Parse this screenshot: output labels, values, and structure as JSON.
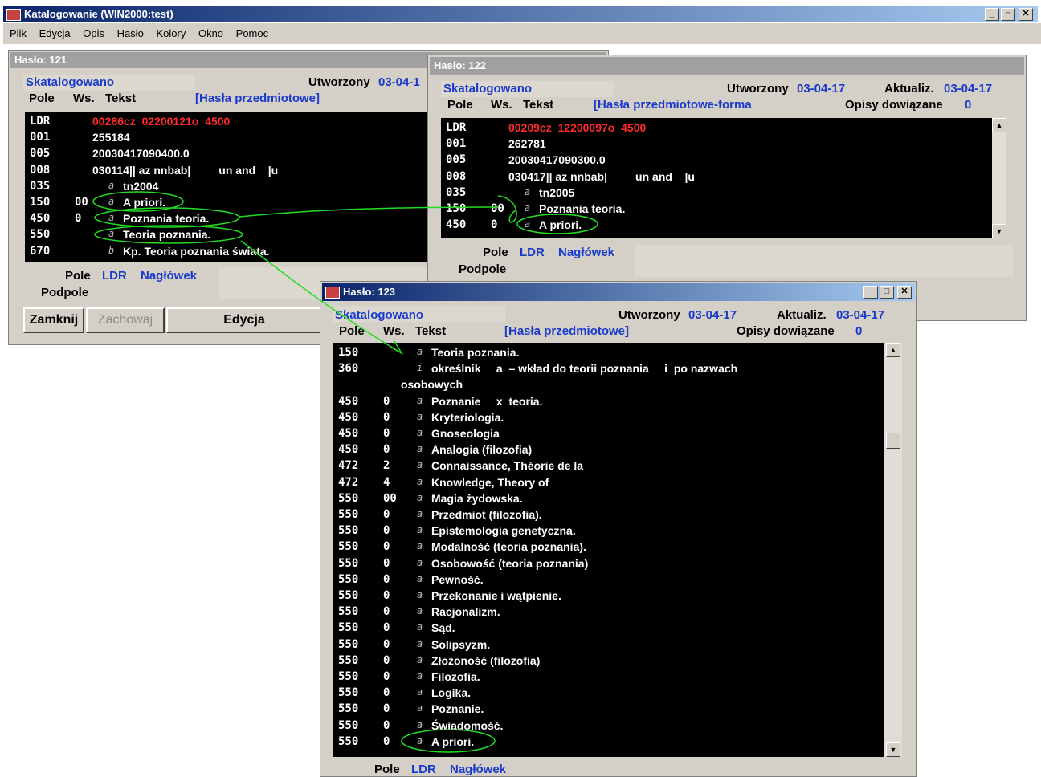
{
  "app": {
    "title": "Katalogowanie (WIN2000:test)",
    "controls": [
      "_",
      "▫",
      "✕"
    ]
  },
  "menu": [
    "Plik",
    "Edycja",
    "Opis",
    "Hasło",
    "Kolory",
    "Okno",
    "Pomoc"
  ],
  "w121": {
    "title": "Hasło: 121",
    "status": "Skatalogowano",
    "created_label": "Utworzony",
    "created": "03-04-1",
    "col_pole": "Pole",
    "col_ws": "Ws.",
    "col_tekst": "Tekst",
    "heading": "[Hasła przedmiotowe]",
    "rows": [
      {
        "tag": "LDR",
        "ind": "",
        "sf": "",
        "text": "00286cz  02200121o  4500",
        "red": true
      },
      {
        "tag": "001",
        "ind": "",
        "sf": "",
        "text": "255184"
      },
      {
        "tag": "005",
        "ind": "",
        "sf": "",
        "text": "20030417090400.0"
      },
      {
        "tag": "008",
        "ind": "",
        "sf": "",
        "text": "030114|| az nnbab|         un and    |u"
      },
      {
        "tag": "035",
        "ind": "",
        "sf": "a",
        "text": "tn2004"
      },
      {
        "tag": "150",
        "ind": "00",
        "sf": "a",
        "text": "A priori."
      },
      {
        "tag": "450",
        "ind": "0",
        "sf": "a",
        "text": "Poznania teoria."
      },
      {
        "tag": "550",
        "ind": "",
        "sf": "a",
        "text": "Teoria poznania."
      },
      {
        "tag": "670",
        "ind": "",
        "sf": "b",
        "text": "Kp. Teoria poznania świata."
      }
    ],
    "pole_label": "Pole",
    "ldr": "LDR",
    "naglowek": "Nagłówek",
    "podpole_label": "Podpole",
    "btn_close": "Zamknij",
    "btn_save": "Zachowaj",
    "btn_edit": "Edycja"
  },
  "w122": {
    "title": "Hasło: 122",
    "status": "Skatalogowano",
    "created_label": "Utworzony",
    "created": "03-04-17",
    "updated_label": "Aktualiz.",
    "updated": "03-04-17",
    "col_pole": "Pole",
    "col_ws": "Ws.",
    "col_tekst": "Tekst",
    "heading": "[Hasła przedmiotowe-forma",
    "linked_label": "Opisy dowiązane",
    "linked": "0",
    "rows": [
      {
        "tag": "LDR",
        "ind": "",
        "sf": "",
        "text": "00209cz  12200097o  4500",
        "red": true
      },
      {
        "tag": "001",
        "ind": "",
        "sf": "",
        "text": "262781"
      },
      {
        "tag": "005",
        "ind": "",
        "sf": "",
        "text": "20030417090300.0"
      },
      {
        "tag": "008",
        "ind": "",
        "sf": "",
        "text": "030417|| az nnbab|         un and    |u"
      },
      {
        "tag": "035",
        "ind": "",
        "sf": "a",
        "text": "tn2005"
      },
      {
        "tag": "150",
        "ind": "00",
        "sf": "a",
        "text": "Poznania teoria."
      },
      {
        "tag": "450",
        "ind": "0",
        "sf": "a",
        "text": "A priori."
      }
    ],
    "pole_label": "Pole",
    "ldr": "LDR",
    "naglowek": "Nagłówek",
    "podpole_label": "Podpole"
  },
  "w123": {
    "title": "Hasło: 123",
    "status": "Skatalogowano",
    "created_label": "Utworzony",
    "created": "03-04-17",
    "updated_label": "Aktualiz.",
    "updated": "03-04-17",
    "col_pole": "Pole",
    "col_ws": "Ws.",
    "col_tekst": "Tekst",
    "heading": "[Hasła przedmiotowe]",
    "linked_label": "Opisy dowiązane",
    "linked": "0",
    "rows": [
      {
        "tag": "150",
        "ind": "",
        "sf": "a",
        "text": "Teoria poznania."
      },
      {
        "tag": "360",
        "ind": "",
        "sf": "i",
        "text": "określnik     a  – wkład do teorii poznania     i  po nazwach"
      },
      {
        "tag": "",
        "ind": "",
        "sf": "",
        "text": "osobowych"
      },
      {
        "tag": "450",
        "ind": "0",
        "sf": "a",
        "text": "Poznanie     x  teoria."
      },
      {
        "tag": "450",
        "ind": "0",
        "sf": "a",
        "text": "Kryteriologia."
      },
      {
        "tag": "450",
        "ind": "0",
        "sf": "a",
        "text": "Gnoseologia"
      },
      {
        "tag": "450",
        "ind": "0",
        "sf": "a",
        "text": "Analogia (filozofia)"
      },
      {
        "tag": "472",
        "ind": "2",
        "sf": "a",
        "text": "Connaissance, Théorie de la"
      },
      {
        "tag": "472",
        "ind": "4",
        "sf": "a",
        "text": "Knowledge, Theory of"
      },
      {
        "tag": "550",
        "ind": "00",
        "sf": "a",
        "text": "Magia żydowska."
      },
      {
        "tag": "550",
        "ind": "0",
        "sf": "a",
        "text": "Przedmiot (filozofia)."
      },
      {
        "tag": "550",
        "ind": "0",
        "sf": "a",
        "text": "Epistemologia genetyczna."
      },
      {
        "tag": "550",
        "ind": "0",
        "sf": "a",
        "text": "Modalność (teoria poznania)."
      },
      {
        "tag": "550",
        "ind": "0",
        "sf": "a",
        "text": "Osobowość (teoria poznania)"
      },
      {
        "tag": "550",
        "ind": "0",
        "sf": "a",
        "text": "Pewność."
      },
      {
        "tag": "550",
        "ind": "0",
        "sf": "a",
        "text": "Przekonanie i wątpienie."
      },
      {
        "tag": "550",
        "ind": "0",
        "sf": "a",
        "text": "Racjonalizm."
      },
      {
        "tag": "550",
        "ind": "0",
        "sf": "a",
        "text": "Sąd."
      },
      {
        "tag": "550",
        "ind": "0",
        "sf": "a",
        "text": "Solipsyzm."
      },
      {
        "tag": "550",
        "ind": "0",
        "sf": "a",
        "text": "Złożoność (filozofia)"
      },
      {
        "tag": "550",
        "ind": "0",
        "sf": "a",
        "text": "Filozofia."
      },
      {
        "tag": "550",
        "ind": "0",
        "sf": "a",
        "text": "Logika."
      },
      {
        "tag": "550",
        "ind": "0",
        "sf": "a",
        "text": "Poznanie."
      },
      {
        "tag": "550",
        "ind": "0",
        "sf": "a",
        "text": "Świadomość."
      },
      {
        "tag": "550",
        "ind": "0",
        "sf": "a",
        "text": "A priori."
      }
    ],
    "pole_label": "Pole",
    "ldr": "LDR",
    "naglowek": "Nagłówek",
    "controls": [
      "_",
      "□",
      "✕"
    ]
  },
  "colors": {
    "annotation": "#22dd22",
    "blue_text": "#1a3acc",
    "red_text": "#ff2a2a"
  }
}
